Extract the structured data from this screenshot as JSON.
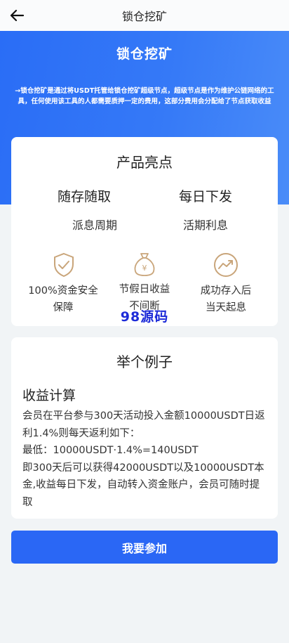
{
  "topbar": {
    "title": "锁仓挖矿",
    "back_icon": "arrow-left-icon"
  },
  "hero": {
    "title": "锁仓挖矿",
    "description": "→锁仓挖矿是通过将USDT托管给锁仓挖矿超级节点，超级节点是作为维护公链网络的工具，任何使用该工具的人都需要质押一定的费用，这部分费用会分配给了节点获取收益"
  },
  "highlights": {
    "title": "产品亮点",
    "features": [
      {
        "label": "随存随取",
        "sub": "派息周期"
      },
      {
        "label": "每日下发",
        "sub": "活期利息"
      }
    ],
    "icons": [
      {
        "icon": "shield-check-icon",
        "line1": "100%资金安全",
        "line2": "保障"
      },
      {
        "icon": "money-bag-icon",
        "line1": "节假日收益",
        "line2": "不间断"
      },
      {
        "icon": "trend-up-icon",
        "line1": "成功存入后",
        "line2": "当天起息"
      }
    ],
    "icon_color": "#c9a57a"
  },
  "watermark": "98源码",
  "example": {
    "title": "举个例子",
    "calc_title": "收益计算",
    "lines": [
      "会员在平台参与300天活动投入金额10000USDT日返利1.4%则每天返利如下：",
      "最低：10000USDT·1.4%=140USDT",
      "即300天后可以获得42000USDT以及10000USDT本金,收益每日下发，自动转入资金账户，会员可随时提取"
    ]
  },
  "join_button": "我要参加",
  "colors": {
    "primary": "#2a67f5",
    "hero_gradient_start": "#2a6df6",
    "hero_gradient_end": "#4a8cf8",
    "background": "#f1f4f6"
  }
}
